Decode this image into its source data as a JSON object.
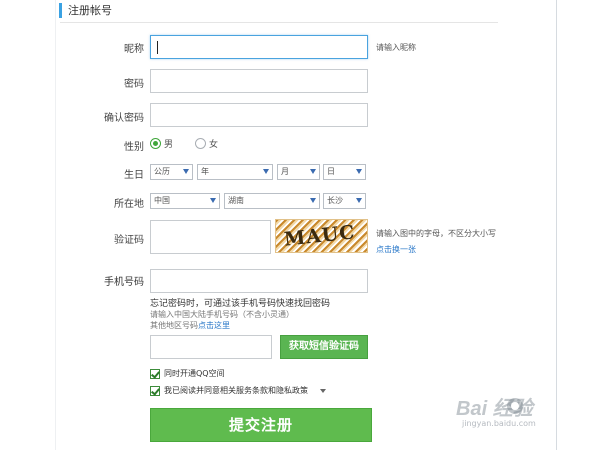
{
  "section": {
    "title": "注册帐号"
  },
  "fields": {
    "nickname": {
      "label": "昵称",
      "value": "",
      "hint": "请输入昵称"
    },
    "password": {
      "label": "密码",
      "value": ""
    },
    "confirm_password": {
      "label": "确认密码",
      "value": ""
    },
    "gender": {
      "label": "性别",
      "options": [
        "男",
        "女"
      ],
      "selected": "男"
    },
    "birthday": {
      "label": "生日",
      "calendar": "公历",
      "year": "年",
      "month": "月",
      "day": "日"
    },
    "location": {
      "label": "所在地",
      "country": "中国",
      "province": "湖南",
      "city": "长沙"
    },
    "captcha": {
      "label": "验证码",
      "value": "",
      "image_text": "MAUC",
      "hint": "请输入图中的字母，不区分大小写",
      "refresh_link": "点击换一张"
    },
    "phone": {
      "label": "手机号码",
      "value": "",
      "note": "忘记密码时，可通过该手机号码快速找回密码",
      "sub_note": "请输入中国大陆手机号码（不含小灵通）",
      "other_region_prefix": "其他地区号码",
      "other_region_link": "点击这里"
    },
    "sms": {
      "value": "",
      "button_label": "获取短信验证码"
    }
  },
  "checkboxes": {
    "qzone": {
      "label": "同时开通QQ空间",
      "checked": true
    },
    "agree": {
      "label": "我已阅读并同意相关服务条款和隐私政策",
      "checked": true
    }
  },
  "submit": {
    "label": "提交注册"
  },
  "watermark": {
    "brand": "Bai 经验",
    "url": "jingyan.baidu.com"
  },
  "colors": {
    "accent_blue": "#3aa2e3",
    "button_green": "#5fbb4e",
    "link_blue": "#2a78c9"
  }
}
